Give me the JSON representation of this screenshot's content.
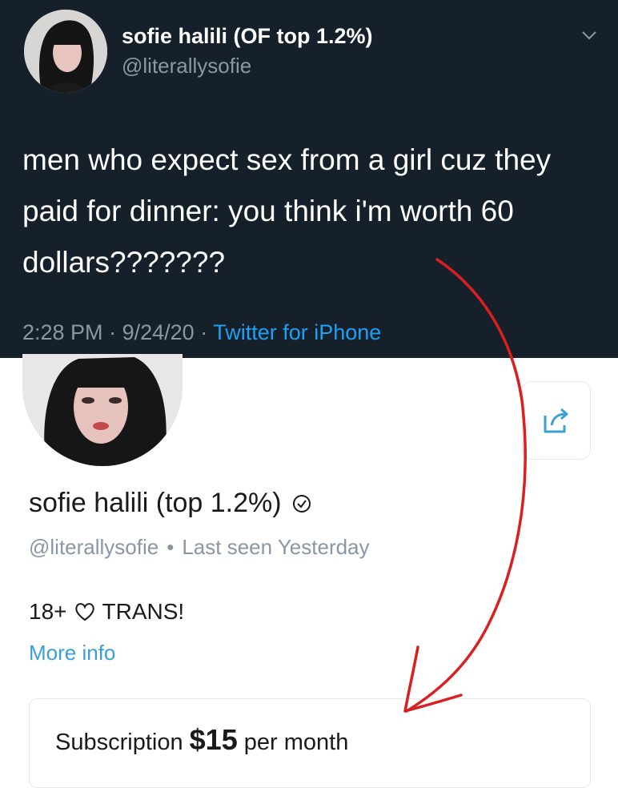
{
  "tweet": {
    "display_name": "sofie halili (OF top 1.2%)",
    "handle": "@literallysofie",
    "text": "men who expect sex from a girl cuz they paid for dinner: you think i'm worth 60 dollars???????",
    "time": "2:28 PM",
    "date": "9/24/20",
    "separator": "·",
    "source": "Twitter for iPhone",
    "menu_icon": "chevron-down-icon"
  },
  "profile": {
    "display_name": "sofie halili (top 1.2%)",
    "handle": "@literallysofie",
    "separator": "•",
    "last_seen": "Last seen Yesterday",
    "bio_left": "18+",
    "bio_right": "TRANS!",
    "more_info": "More info",
    "subscription_label": "Subscription",
    "subscription_price": "$15",
    "subscription_period": "per month",
    "accent_color": "#3a9fd6"
  },
  "annotation": {
    "color": "#d91f1f"
  }
}
